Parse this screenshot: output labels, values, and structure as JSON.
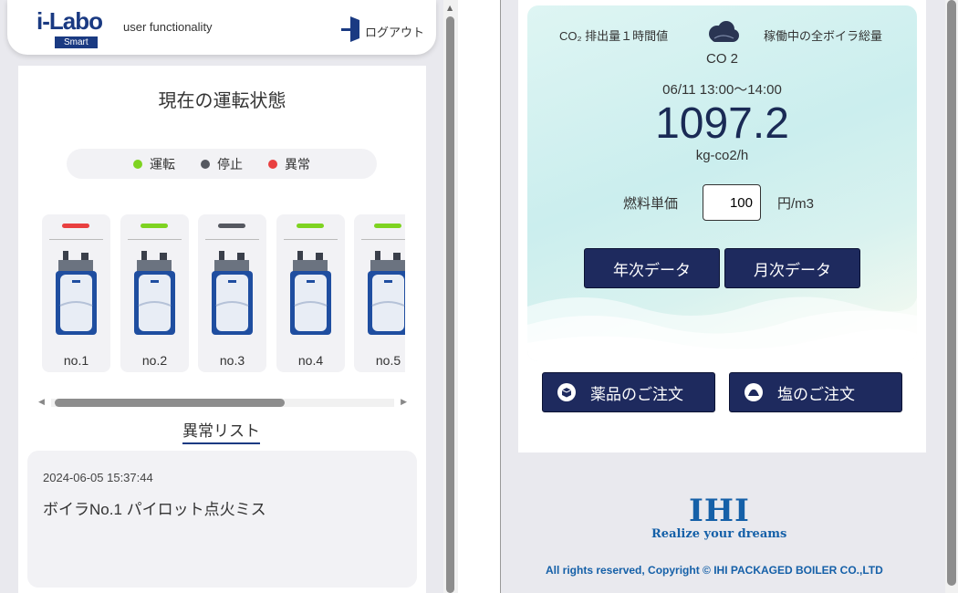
{
  "header": {
    "logo_text": "i-Labo",
    "logo_sub": "Smart",
    "subtitle": "user functionality",
    "logout_label": "ログアウト"
  },
  "status": {
    "title": "現在の運転状態",
    "legend": [
      {
        "label": "運転",
        "color": "#7ed321"
      },
      {
        "label": "停止",
        "color": "#555860"
      },
      {
        "label": "異常",
        "color": "#e94040"
      }
    ],
    "boilers": [
      {
        "label": "no.1",
        "state_color": "#e94040"
      },
      {
        "label": "no.2",
        "state_color": "#7ed321"
      },
      {
        "label": "no.3",
        "state_color": "#555860"
      },
      {
        "label": "no.4",
        "state_color": "#7ed321"
      },
      {
        "label": "no.5",
        "state_color": "#7ed321"
      }
    ]
  },
  "anomaly": {
    "title": "異常リスト",
    "items": [
      {
        "time": "2024-06-05 15:37:44",
        "message": "ボイラNo.1 パイロット点火ミス"
      }
    ]
  },
  "co2": {
    "left_label": "CO₂ 排出量１時間値",
    "right_label": "稼働中の全ボイラ総量",
    "name": "CO 2",
    "period": "06/11 13:00～14:00",
    "value": "1097.2",
    "unit": "kg-co2/h",
    "fuel_label": "燃料単価",
    "fuel_value": "100",
    "fuel_unit": "円/m3",
    "annual_button": "年次データ",
    "monthly_button": "月次データ"
  },
  "orders": {
    "chemicals": "薬品のご注文",
    "salt": "塩のご注文"
  },
  "footer": {
    "brand": "IHI",
    "tagline": "Realize your dreams",
    "copyright": "All rights reserved, Copyright © IHI PACKAGED BOILER CO.,LTD"
  },
  "colors": {
    "brand_navy": "#1e2a5e",
    "ihi_blue": "#1560a8"
  }
}
